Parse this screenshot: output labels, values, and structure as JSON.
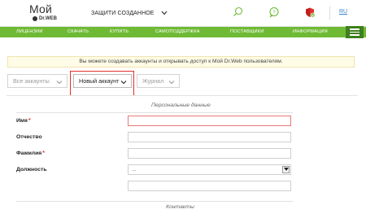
{
  "header": {
    "logo_top": "Мой",
    "logo_bottom": "Dr.WEB",
    "security_select": "ЗАЩИТИ СОЗДАННОЕ",
    "lang": "RU"
  },
  "nav": {
    "items": [
      "ЛИЦЕНЗИИ",
      "СКАЧАТЬ",
      "КУПИТЬ",
      "САМОПОДДЕРЖКА",
      "ПОСТАВЩИКИ",
      "ИНФОРМАЦИЯ"
    ]
  },
  "banner": {
    "text": "Вы можете создавать аккаунты и открывать доступ к Мой Dr.Web пользователям."
  },
  "tabs": {
    "all_accounts": "Все аккаунты",
    "new_account": "Новый аккаунт",
    "journal": "Журнал"
  },
  "form": {
    "personal_title": "Персональные данные",
    "first_name_label": "Имя",
    "patronymic_label": "Отчество",
    "last_name_label": "Фамилия",
    "position_label": "Должность",
    "position_value": "...",
    "contacts_title": "Контакты",
    "required_mark": "*"
  },
  "colors": {
    "nav_green": "#6fba35",
    "burger_green": "#3f7f1e",
    "highlight_red": "#e0312e",
    "banner_bg": "#fefbe6"
  }
}
